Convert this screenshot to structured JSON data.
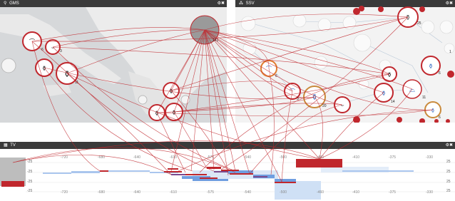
{
  "panels": {
    "gms": {
      "title": "GMS",
      "icon": "map-pin-icon",
      "controls": "⚙✖"
    },
    "ssv": {
      "title": "SSV",
      "icon": "network-icon",
      "controls": "⚙✖"
    },
    "tv": {
      "title": "TV",
      "icon": "calendar-icon",
      "controls": "⚙✖"
    }
  },
  "gms_counts": [
    "6",
    "3",
    "11",
    "141"
  ],
  "ssv_counts": [
    "25",
    "6",
    "3",
    "20",
    "14",
    "11",
    "6",
    "6",
    "1"
  ],
  "tv_top_ticks": [
    "-720",
    "-680",
    "-640",
    "-610",
    "-575",
    "-540",
    "-500",
    "-460",
    "-410",
    "-375",
    "-330"
  ],
  "tv_bottom_ticks": [
    "-720",
    "-680",
    "-640",
    "-610",
    "-575",
    "-540",
    "-500",
    "-460",
    "-410",
    "-375",
    "-330"
  ],
  "tv_row_labels": [
    "-25",
    "-25",
    "-25",
    "-25"
  ],
  "tv_right_labels": [
    "25",
    "25",
    "25",
    "25"
  ],
  "colors": {
    "link": "#c0272d",
    "highlight": "#a9c8ea",
    "bar": "#5b8fd6",
    "selection": "#d84545"
  }
}
